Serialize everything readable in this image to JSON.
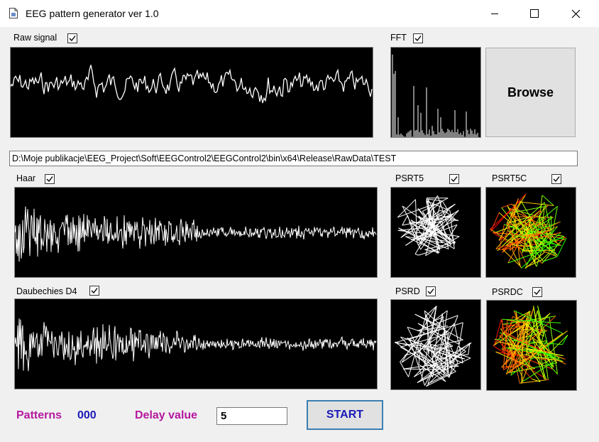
{
  "window": {
    "title": "EEG pattern generator ver 1.0",
    "minimize_icon": "minimize-icon",
    "maximize_icon": "maximize-icon",
    "close_icon": "close-icon"
  },
  "panels": {
    "raw_signal": {
      "label": "Raw signal",
      "checked": true
    },
    "fft": {
      "label": "FFT",
      "checked": true
    },
    "haar": {
      "label": "Haar",
      "checked": true
    },
    "daubechies": {
      "label": "Daubechies D4",
      "checked": true
    },
    "psrt5": {
      "label": "PSRT5",
      "checked": true
    },
    "psrt5c": {
      "label": "PSRT5C",
      "checked": true
    },
    "psrd": {
      "label": "PSRD",
      "checked": true
    },
    "psrdc": {
      "label": "PSRDC",
      "checked": true
    }
  },
  "browse_label": "Browse",
  "path_value": "D:\\Moje publikacje\\EEG_Project\\Soft\\EEGControl2\\EEGControl2\\bin\\x64\\Release\\RawData\\TEST",
  "footer": {
    "patterns_label": "Patterns",
    "patterns_value": "000",
    "delay_label": "Delay value",
    "delay_value": "5",
    "start_label": "START"
  },
  "colors": {
    "label_magenta": "#b5179e",
    "value_blue": "#1a1ab8",
    "start_blue": "#1a1ab8",
    "plot_bg": "#000000",
    "trace_white": "#ffffff"
  }
}
